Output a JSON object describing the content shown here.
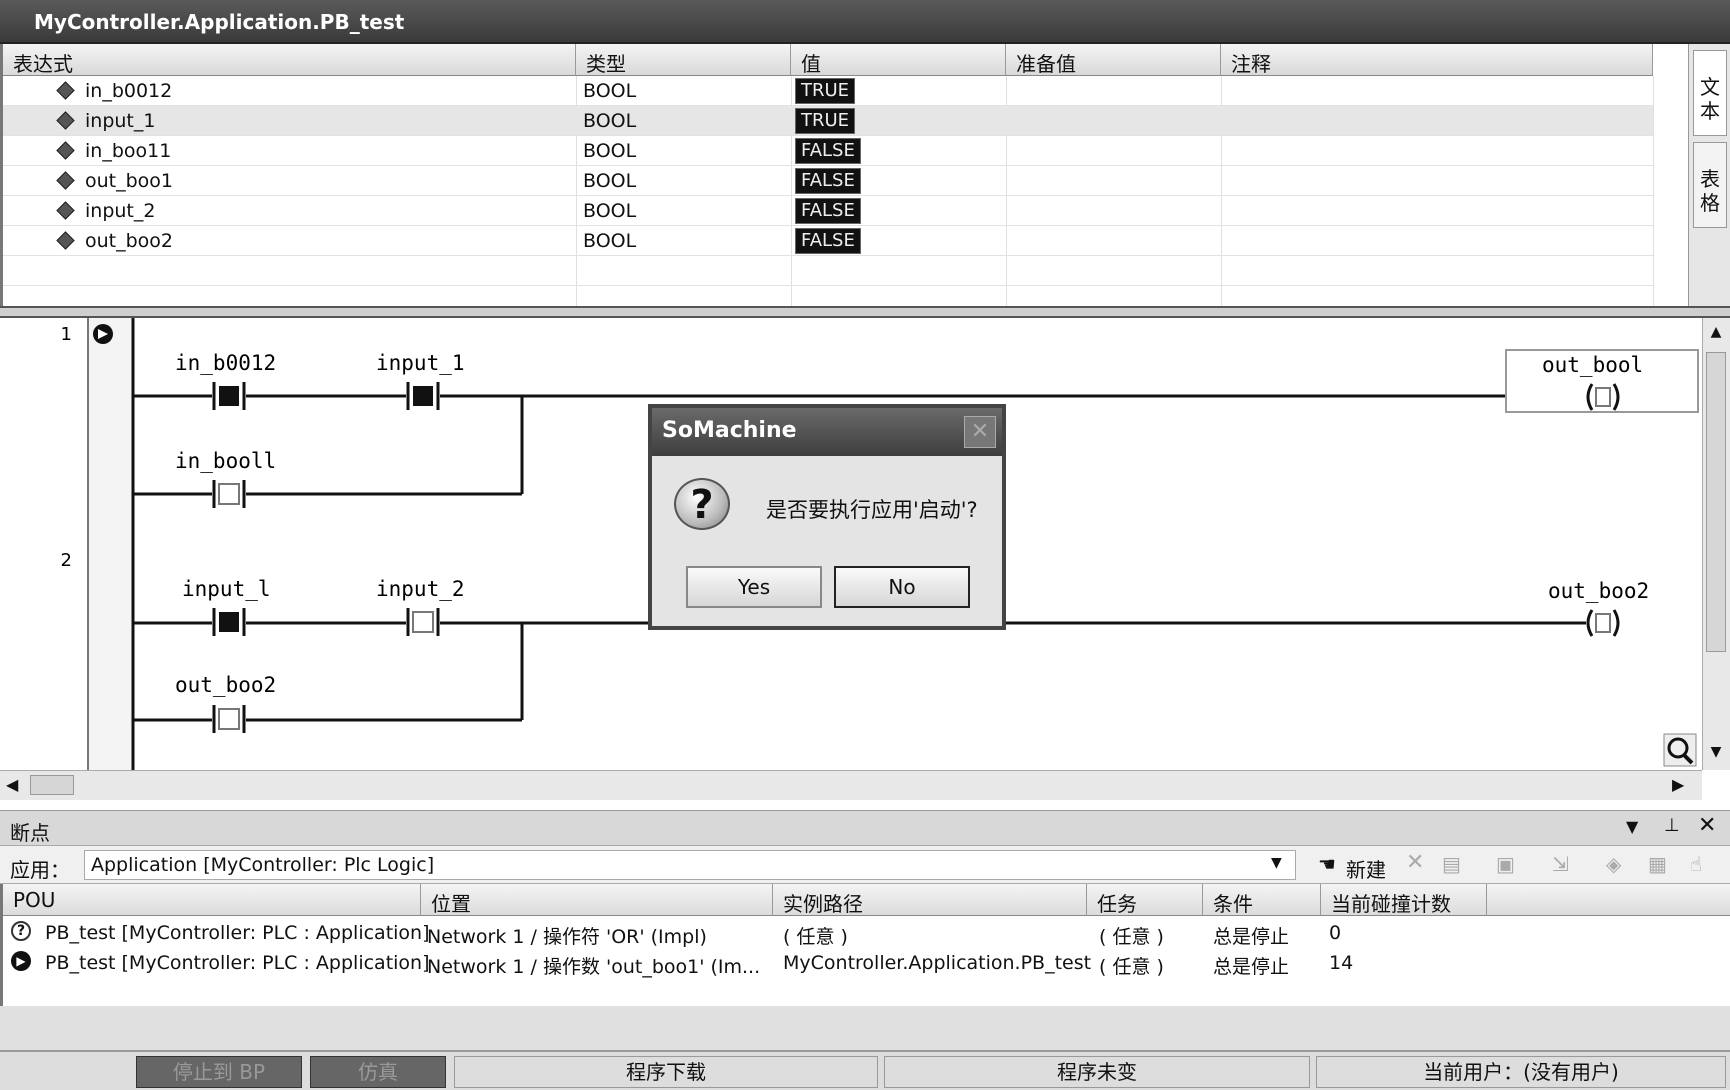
{
  "window": {
    "title": "MyController.Application.PB_test"
  },
  "watch": {
    "columns": [
      "表达式",
      "类型",
      "值",
      "准备值",
      "注释"
    ],
    "rows": [
      {
        "name": "in_b0012",
        "type": "BOOL",
        "value": "TRUE"
      },
      {
        "name": "input_1",
        "type": "BOOL",
        "value": "TRUE"
      },
      {
        "name": "in_boo11",
        "type": "BOOL",
        "value": "FALSE"
      },
      {
        "name": "out_boo1",
        "type": "BOOL",
        "value": "FALSE"
      },
      {
        "name": "input_2",
        "type": "BOOL",
        "value": "FALSE"
      },
      {
        "name": "out_boo2",
        "type": "BOOL",
        "value": "FALSE"
      }
    ],
    "side_tabs": [
      "文本",
      "表格"
    ]
  },
  "ladder": {
    "networks": [
      "1",
      "2"
    ],
    "net1": {
      "c1": "in_b0012",
      "c2": "input_1",
      "c3": "in_booll",
      "coil": "out_bool"
    },
    "net2": {
      "c1": "input_l",
      "c2": "input_2",
      "c3": "out_boo2",
      "coil": "out_boo2"
    }
  },
  "dialog": {
    "title": "SoMachine",
    "message": "是否要执行应用'启动'?",
    "yes": "Yes",
    "no": "No"
  },
  "breakpoints": {
    "panel_title": "断点",
    "app_label": "应用：",
    "app_value": "Application [MyController: Plc Logic]",
    "new_label": "新建",
    "columns": [
      "POU",
      "位置",
      "实例路径",
      "任务",
      "条件",
      "当前碰撞计数"
    ],
    "rows": [
      {
        "pou": "PB_test [MyController: PLC : Application]",
        "position": "Network 1 / 操作符 'OR' (Impl)",
        "path": "( 任意 )",
        "task": "( 任意 )",
        "condition": "总是停止",
        "count": "0"
      },
      {
        "pou": "PB_test [MyController: PLC : Application]",
        "position": "Network 1 / 操作数 'out_boo1' (Im...",
        "path": "MyController.Application.PB_test",
        "task": "( 任意 )",
        "condition": "总是停止",
        "count": "14"
      }
    ]
  },
  "status": {
    "stop_bp": "停止到 BP",
    "simulate": "仿真",
    "download": "程序下载",
    "unchanged": "程序未变",
    "user": "当前用户：(没有用户)"
  }
}
